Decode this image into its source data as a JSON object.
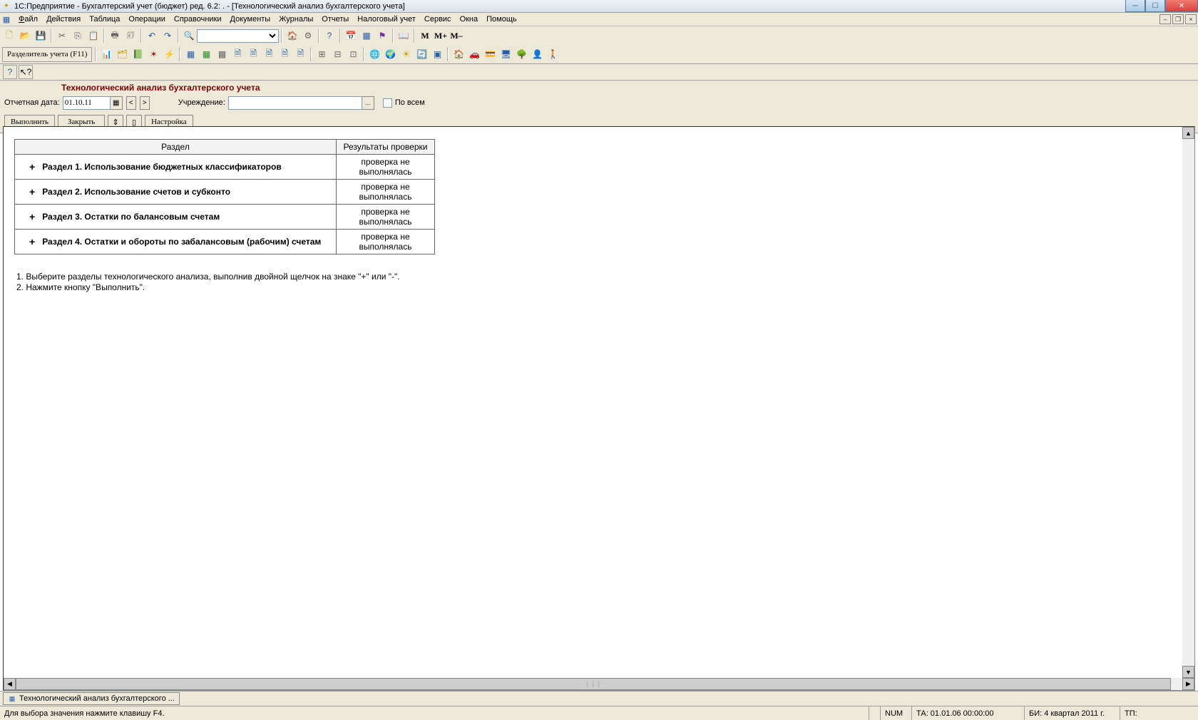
{
  "titlebar": {
    "app": "1С:Предприятие - Бухгалтерский учет (бюджет) ред. 6.2:",
    "dbpath": ". ",
    "doc": "- [Технологический анализ бухгалтерского учета]"
  },
  "menu": {
    "file": "Файл",
    "actions": "Действия",
    "table": "Таблица",
    "operations": "Операции",
    "refs": "Справочники",
    "docs": "Документы",
    "journals": "Журналы",
    "reports": "Отчеты",
    "tax": "Налоговый учет",
    "service": "Сервис",
    "windows": "Окна",
    "help": "Помощь"
  },
  "toolbar2": {
    "separator_label": "Разделитель учета (F11)"
  },
  "mem": {
    "m": "M",
    "mplus": "M+",
    "mminus": "M–"
  },
  "form": {
    "title": "Технологический анализ бухгалтерского учета",
    "date_label": "Отчетная дата:",
    "date_value": "01.10.11",
    "inst_label": "Учреждение:",
    "inst_value": "",
    "all_label": "По всем",
    "btn_run": "Выполнить",
    "btn_close": "Закрыть",
    "btn_settings": "Настройка"
  },
  "table": {
    "header_section": "Раздел",
    "header_result": "Результаты проверки",
    "rows": [
      {
        "title": "Раздел 1. Использование бюджетных классификаторов",
        "result": "проверка не выполнялась"
      },
      {
        "title": "Раздел 2. Использование счетов и субконто",
        "result": "проверка не выполнялась"
      },
      {
        "title": "Раздел 3. Остатки по балансовым счетам",
        "result": "проверка не выполнялась"
      },
      {
        "title": "Раздел 4. Остатки и обороты по забалансовым (рабочим) счетам",
        "result": "проверка не выполнялась"
      }
    ]
  },
  "instructions": {
    "l1": "1. Выберите разделы технологического анализа, выполнив двойной щелчок на знаке \"+\" или \"-\".",
    "l2": "2. Нажмите кнопку \"Выполнить\"."
  },
  "wintab": {
    "label": "Технологический анализ бухгалтерского ..."
  },
  "status": {
    "hint": "Для выбора значения нажмите клавишу F4.",
    "num": "NUM",
    "ta": "ТА: 01.01.06  00:00:00",
    "bi": "БИ: 4 квартал 2011 г.",
    "tp": "ТП:"
  }
}
